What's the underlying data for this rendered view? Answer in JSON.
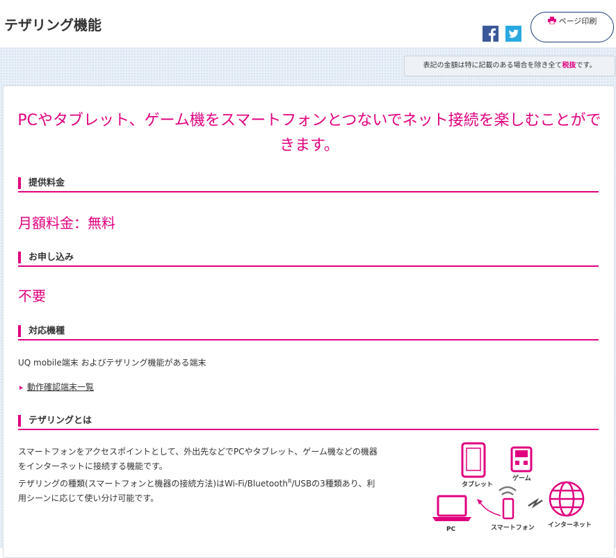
{
  "header": {
    "title": "テザリング機能",
    "print_label": "ページ印刷"
  },
  "tax_note": {
    "before": "表記の金額は特に記載のある場合を除き全て",
    "highlight": "税抜",
    "after": "です。"
  },
  "lead": "PCやタブレット、ゲーム機をスマートフォンとつないでネット接続を楽しむことができます。",
  "sections": {
    "price": {
      "label": "提供料金",
      "value": "月額料金：無料"
    },
    "apply": {
      "label": "お申し込み",
      "value": "不要"
    },
    "devices": {
      "label": "対応機種",
      "text": "UQ mobile端末 およびテザリング機能がある端末",
      "link": "動作確認端末一覧"
    },
    "about": {
      "label": "テザリングとは",
      "p1a": "スマートフォンをアクセスポイントとして、外出先などでPCやタブレット、ゲーム機などの機器",
      "p1b": "をインターネットに接続する機能です。",
      "p2a_before": "テザリングの種類(スマートフォンと機器の接続方法)はWi-Fi/Bluetooth",
      "p2a_sup": "R",
      "p2a_after": "/USBの3種類あり、利",
      "p2b": "用シーンに応じて使い分け可能です。"
    }
  },
  "illustration": {
    "tablet": "タブレット",
    "game": "ゲーム",
    "pc": "PC",
    "smartphone": "スマートフォン",
    "internet": "インターネット"
  },
  "colors": {
    "accent": "#e0007f",
    "facebook": "#3b5998",
    "twitter": "#2aa9e0"
  },
  "icons": [
    "facebook-icon",
    "twitter-icon",
    "printer-icon"
  ]
}
